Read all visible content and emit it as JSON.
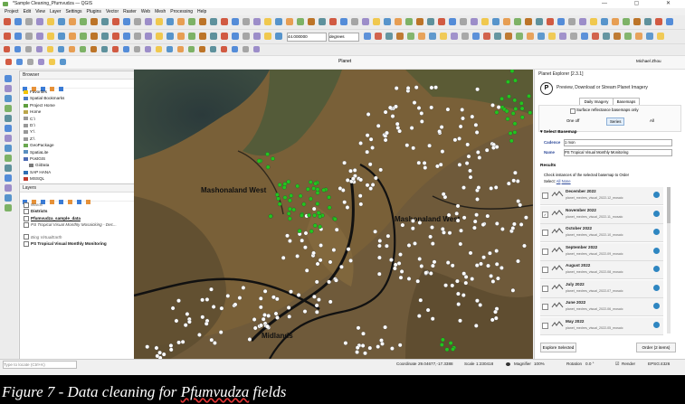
{
  "window": {
    "title": "*Sample Cleaning_Pfumvudza — QGIS"
  },
  "menu": [
    "Project",
    "Edit",
    "View",
    "Layer",
    "Settings",
    "Plugins",
    "Vector",
    "Raster",
    "Web",
    "Mesh",
    "Processing",
    "Help"
  ],
  "toolbar": {
    "scale_value": "44.000000",
    "rotation_unit": "degrees",
    "planet_label": "Planet",
    "user": "Michael Zhou"
  },
  "browser": {
    "title": "Browser",
    "items": [
      "Favorites",
      "Spatial Bookmarks",
      "Project Home",
      "Home",
      "C:\\",
      "D:\\",
      "Y:\\",
      "Z:\\",
      "GeoPackage",
      "SpatiaLite",
      "PostGIS",
      "GiiData",
      "SAP HANA",
      "MSSQL",
      "Oracle"
    ]
  },
  "layers": {
    "title": "Layers",
    "items": [
      "Wards",
      "Districts",
      "Pfumvudza_sample_data",
      "PS Tropical Visual Monthly Mosaicking - Dec...",
      "Bing VirtualEarth",
      "PS Tropical Visual Monthly Monitoring"
    ]
  },
  "map": {
    "labels": [
      "Mashonaland West",
      "Mashonaland West",
      "Midlands"
    ]
  },
  "planet": {
    "title": "Planet Explorer [2.3.1]",
    "heading": "Preview, Download or Stream Planet Imagery",
    "tabs": [
      "Daily Imagery",
      "Basemaps"
    ],
    "surface_label": "Surface reflectance basemaps only",
    "order_opts": [
      "One off",
      "Series",
      "All"
    ],
    "select_basemap": "Select Basemap",
    "cadence_label": "Cadence",
    "cadence_value": "1 mon",
    "name_label": "Name",
    "name_value": "PS Tropical Visual Monthly Monitoring",
    "results_label": "Results",
    "results_hint": "Check instances of the selected basemap to Order",
    "select_label": "Select:",
    "select_all": "All",
    "select_none": "None",
    "months": [
      {
        "name": "December 2022",
        "mosaic": "planet_medres_visual_2022-12_mosaic",
        "checked": false
      },
      {
        "name": "November 2022",
        "mosaic": "planet_medres_visual_2022-11_mosaic",
        "checked": true
      },
      {
        "name": "October 2022",
        "mosaic": "planet_medres_visual_2022-10_mosaic",
        "checked": false
      },
      {
        "name": "September 2022",
        "mosaic": "planet_medres_visual_2022-09_mosaic",
        "checked": false
      },
      {
        "name": "August 2022",
        "mosaic": "planet_medres_visual_2022-08_mosaic",
        "checked": false
      },
      {
        "name": "July 2022",
        "mosaic": "planet_medres_visual_2022-07_mosaic",
        "checked": false
      },
      {
        "name": "June 2022",
        "mosaic": "planet_medres_visual_2022-06_mosaic",
        "checked": false
      },
      {
        "name": "May 2022",
        "mosaic": "planet_medres_visual_2022-05_mosaic",
        "checked": false
      }
    ],
    "explore_btn": "Explore Selected",
    "order_btn": "Order (2 items)"
  },
  "status": {
    "search_placeholder": "Type to locate (Ctrl+K)",
    "coordinate_label": "Coordinate",
    "coordinate_value": "29.04677,-17.3388",
    "scale_label": "Scale",
    "scale_value": "1:230418",
    "magnifier_label": "Magnifier",
    "magnifier_value": "100%",
    "rotation_label": "Rotation",
    "rotation_value": "0.0 °",
    "render_label": "Render",
    "crs": "EPSG:4326"
  },
  "caption": {
    "prefix": "Figure 7 - Data cleaning for ",
    "word": "Pfumvudza",
    "suffix": " fields"
  },
  "colors": {
    "field_white": "#ffffff",
    "field_green": "#22c51e",
    "boundary": "#111111",
    "accent": "#2e86c1"
  }
}
